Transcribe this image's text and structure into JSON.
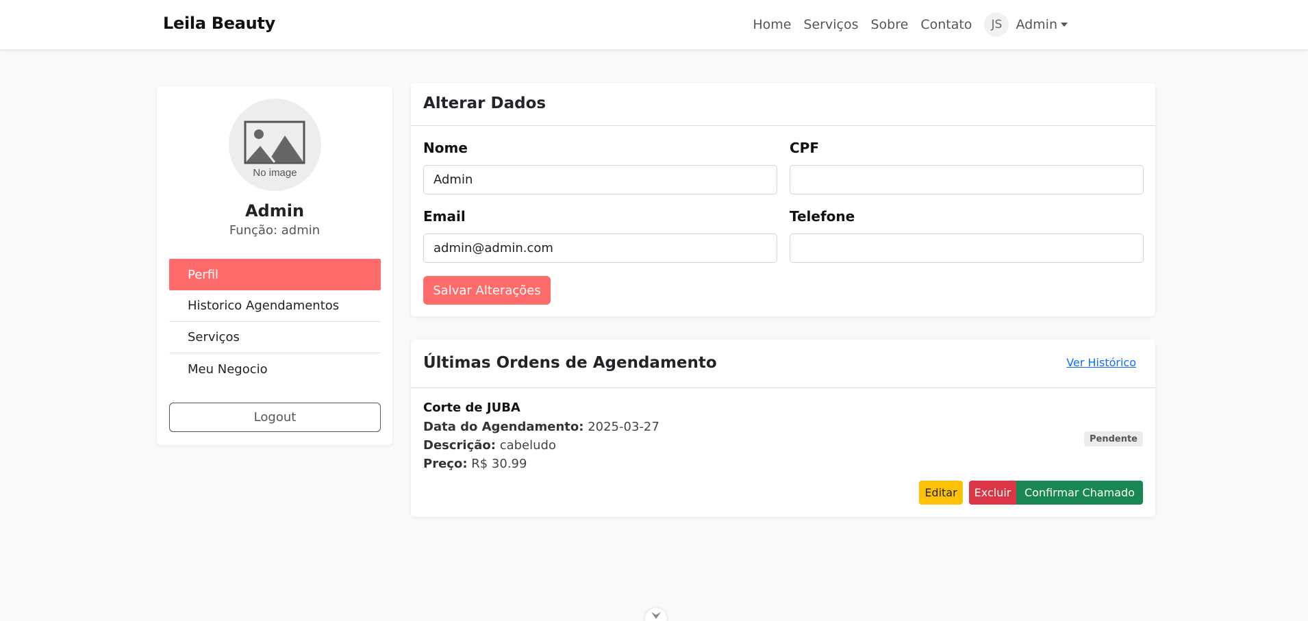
{
  "navbar": {
    "brand": "Leila Beauty",
    "links": [
      "Home",
      "Serviços",
      "Sobre",
      "Contato"
    ],
    "avatar_initials": "JS",
    "user_label": "Admin"
  },
  "sidebar": {
    "image_text": "No image",
    "name": "Admin",
    "role": "Função: admin",
    "menu": [
      "Perfil",
      "Historico Agendamentos",
      "Serviços",
      "Meu Negocio"
    ],
    "active_index": 0,
    "logout_label": "Logout"
  },
  "form": {
    "title": "Alterar Dados",
    "nome_label": "Nome",
    "nome_value": "Admin",
    "cpf_label": "CPF",
    "cpf_value": "",
    "email_label": "Email",
    "email_value": "admin@admin.com",
    "telefone_label": "Telefone",
    "telefone_value": "",
    "save_label": "Salvar Alterações"
  },
  "orders": {
    "title": "Últimas Ordens de Agendamento",
    "history_link": "Ver Histórico",
    "item": {
      "service": "Corte de JUBA",
      "date_label": "Data do Agendamento:",
      "date_value": "2025-03-27",
      "desc_label": "Descrição:",
      "desc_value": "cabeludo",
      "price_label": "Preço:",
      "price_value": "R$ 30.99",
      "status": "Pendente",
      "edit_label": "Editar",
      "delete_label": "Excluir",
      "confirm_label": "Confirmar Chamado"
    }
  },
  "colors": {
    "accent": "#ff6b6b",
    "warning": "#ffc107",
    "danger": "#dc3545",
    "success": "#198754",
    "link": "#0d6efd"
  }
}
